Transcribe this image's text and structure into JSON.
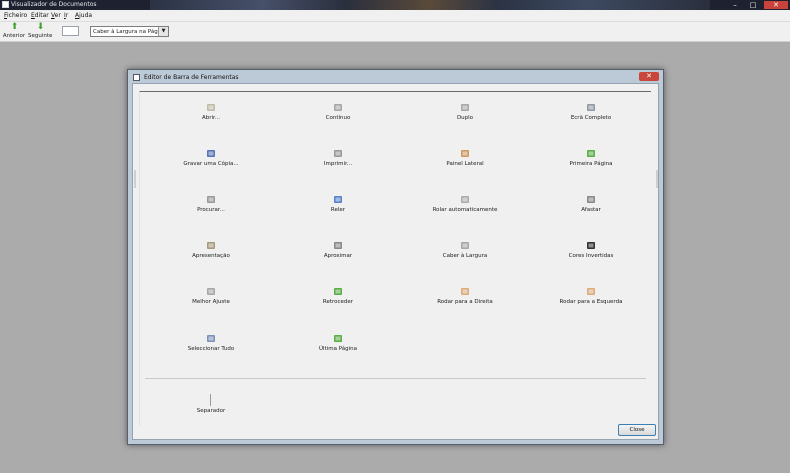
{
  "window": {
    "title": "Visualizador de Documentos"
  },
  "menubar": [
    "Ficheiro",
    "Editar",
    "Ver",
    "Ir",
    "Ajuda"
  ],
  "toolbar": {
    "back_label": "Anterior",
    "next_label": "Seguinte",
    "page_value": "",
    "zoom_value": "Caber à Largura na Página"
  },
  "dialog": {
    "title": "Editor de Barra de Ferramentas",
    "close_label": "Close",
    "separator_label": "Separador",
    "items": [
      {
        "label": "Abrir...",
        "icon": "folder-icon",
        "color": "#b7b09a"
      },
      {
        "label": "Contínuo",
        "icon": "continuous-icon",
        "color": "#9a9a9a"
      },
      {
        "label": "Duplo",
        "icon": "dual-page-icon",
        "color": "#9a9a9a"
      },
      {
        "label": "Ecrã Completo",
        "icon": "fullscreen-icon",
        "color": "#7f8b95"
      },
      {
        "label": "Gravar uma Cópia...",
        "icon": "save-icon",
        "color": "#3a5fa8"
      },
      {
        "label": "Imprimir...",
        "icon": "printer-icon",
        "color": "#8a8a8a"
      },
      {
        "label": "Painel Lateral",
        "icon": "side-pane-icon",
        "color": "#c88a4a"
      },
      {
        "label": "Primeira Página",
        "icon": "first-page-icon",
        "color": "#3fa12a"
      },
      {
        "label": "Procurar...",
        "icon": "search-icon",
        "color": "#8a8a8a"
      },
      {
        "label": "Reler",
        "icon": "reload-icon",
        "color": "#3c6fc2"
      },
      {
        "label": "Rolar automaticamente",
        "icon": "autoscroll-icon",
        "color": "#a0a0a0"
      },
      {
        "label": "Afastar",
        "icon": "zoom-out-icon",
        "color": "#777777"
      },
      {
        "label": "Apresentação",
        "icon": "presentation-icon",
        "color": "#9a8a6a"
      },
      {
        "label": "Aproximar",
        "icon": "zoom-in-icon",
        "color": "#777777"
      },
      {
        "label": "Caber à Largura",
        "icon": "fit-width-icon",
        "color": "#9a9a9a"
      },
      {
        "label": "Cores Invertidas",
        "icon": "inverted-colors-icon",
        "color": "#111111"
      },
      {
        "label": "Melhor Ajuste",
        "icon": "best-fit-icon",
        "color": "#9a9a9a"
      },
      {
        "label": "Retroceder",
        "icon": "back-icon",
        "color": "#3fa12a"
      },
      {
        "label": "Rodar para a Direita",
        "icon": "rotate-right-icon",
        "color": "#d9a066"
      },
      {
        "label": "Rodar para a Esquerda",
        "icon": "rotate-left-icon",
        "color": "#d9a066"
      },
      {
        "label": "Seleccionar Tudo",
        "icon": "select-all-icon",
        "color": "#6a7fb0"
      },
      {
        "label": "Última Página",
        "icon": "last-page-icon",
        "color": "#3fa12a"
      }
    ]
  }
}
